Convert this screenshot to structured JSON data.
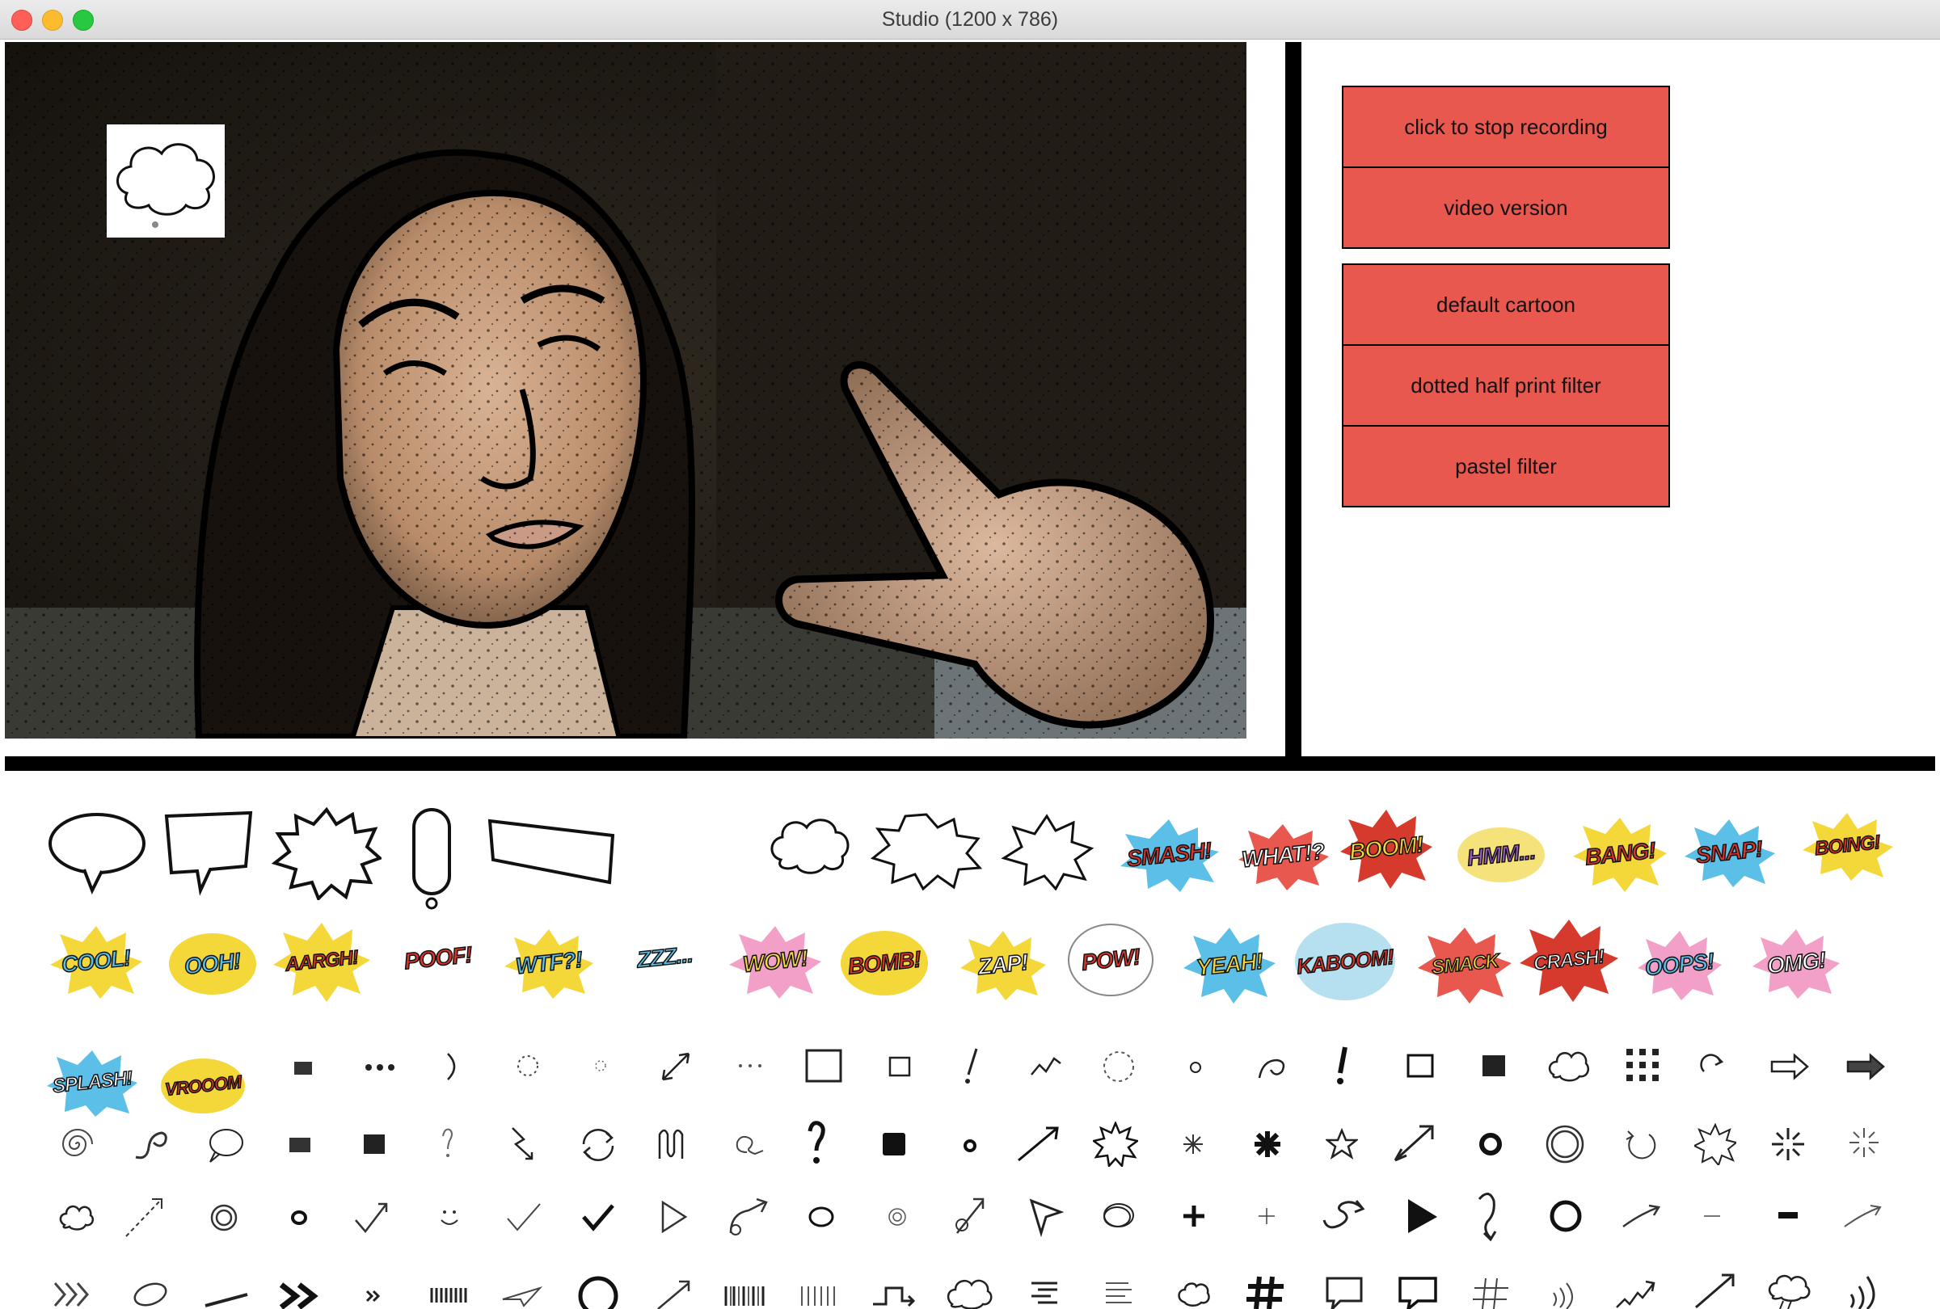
{
  "window": {
    "title": "Studio (1200 x 786)"
  },
  "controls": {
    "group1": [
      {
        "id": "stop",
        "label": "click to stop recording"
      },
      {
        "id": "video",
        "label": "video version"
      }
    ],
    "group2": [
      {
        "id": "default",
        "label": "default cartoon"
      },
      {
        "id": "dotted",
        "label": "dotted half print filter"
      },
      {
        "id": "pastel",
        "label": "pastel filter"
      }
    ],
    "button_color": "#e8584f"
  },
  "stickers": {
    "words_row1": [
      "SMASH!",
      "WHAT!?",
      "BOOM!",
      "HMM...",
      "BANG!",
      "SNAP!",
      "BOING!"
    ],
    "words_row2": [
      "COOL!",
      "OOH!",
      "AARGH!",
      "POOF!",
      "WTF?!",
      "ZZZ...",
      "WOW!",
      "BOMB!",
      "ZAP!",
      "POW!",
      "YEAH!",
      "KABOOM!",
      "SMACK",
      "CRASH!",
      "OOPS!",
      "OMG!"
    ],
    "words_row3": [
      "SPLASH!",
      "VROOOM"
    ],
    "burst_colors": [
      "#f4d83a",
      "#5bbfe8",
      "#e8584f",
      "#f2a0c8",
      "#f6e27a"
    ]
  }
}
